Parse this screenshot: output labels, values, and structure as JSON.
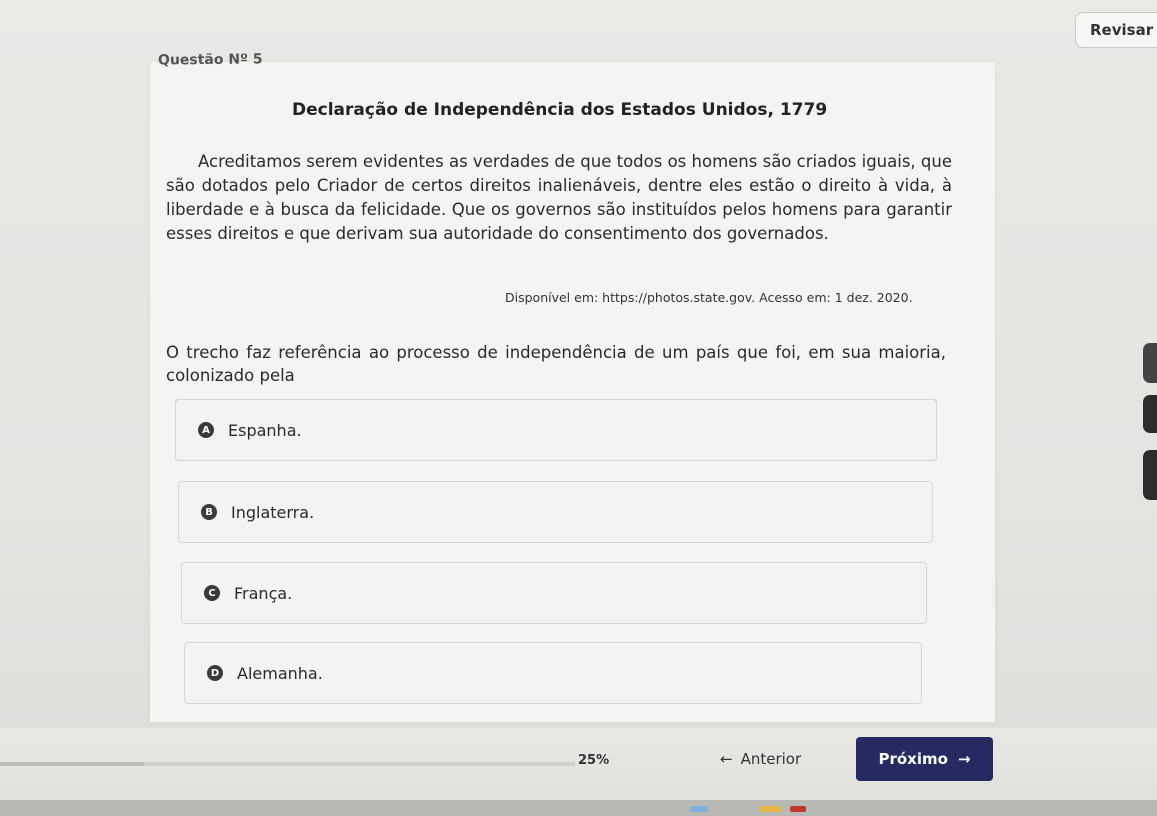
{
  "header": {
    "review_label": "Revisar",
    "question_number": "Questão Nº 5"
  },
  "document": {
    "title": "Declaração de Independência dos Estados Unidos, 1779",
    "text": "Acreditamos serem evidentes as verdades de que todos os homens são criados iguais, que são dotados pelo Criador de certos direitos inalienáveis, dentre eles estão o direito à vida, à liberdade e à busca da felicidade. Que os governos são instituídos pelos homens para garantir esses direitos e que derivam sua autoridade do consentimento dos governados.",
    "source": "Disponível em: https://photos.state.gov. Acesso em: 1 dez. 2020."
  },
  "question": {
    "prompt": "O trecho faz referência ao processo de independência de um país que foi, em sua maioria, colonizado pela"
  },
  "options": [
    {
      "letter": "A",
      "text": "Espanha."
    },
    {
      "letter": "B",
      "text": "Inglaterra."
    },
    {
      "letter": "C",
      "text": "França."
    },
    {
      "letter": "D",
      "text": "Alemanha."
    }
  ],
  "footer": {
    "progress_text": "25%",
    "progress_value": 0.25,
    "previous_label": "Anterior",
    "next_label": "Próximo",
    "next_color": "#262a60"
  }
}
